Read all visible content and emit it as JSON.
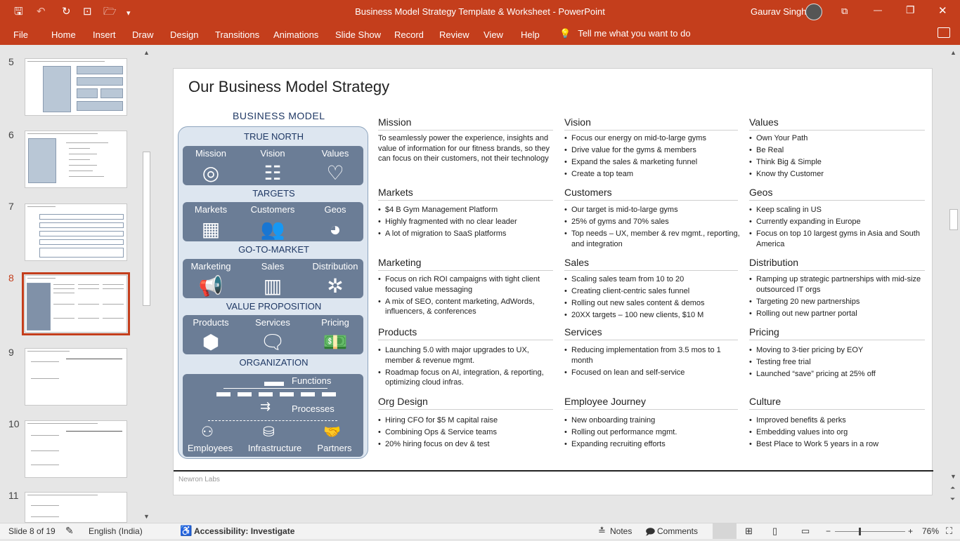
{
  "window": {
    "doc_title": "Business Model Strategy Template & Worksheet  -  PowerPoint",
    "user_name": "Gaurav Singh",
    "qa_save": "🖫",
    "qa_undo": "↶",
    "qa_redo": "↻",
    "qa_present": "⊡",
    "qa_open": "🗁",
    "qa_more": "▾",
    "win_restore": "⧉",
    "win_min": "—",
    "win_max": "❐",
    "win_close": "✕"
  },
  "ribbon": {
    "tabs": [
      "File",
      "Home",
      "Insert",
      "Draw",
      "Design",
      "Transitions",
      "Animations",
      "Slide Show",
      "Record",
      "Review",
      "View",
      "Help"
    ],
    "tell_me": "Tell me what you want to do",
    "bulb": "💡"
  },
  "thumbnails": {
    "numbers": [
      "5",
      "6",
      "7",
      "8",
      "9",
      "10",
      "11"
    ],
    "selected": "8"
  },
  "statusbar": {
    "slide_count": "Slide 8 of 19",
    "language": "English (India)",
    "accessibility": "Accessibility: Investigate",
    "notes": "Notes",
    "comments": "Comments",
    "zoom": "76%",
    "minus": "−",
    "plus": "+"
  },
  "slide": {
    "title": "Our Business Model Strategy",
    "bm_title": "BUSINESS MODEL",
    "footer": "Newron Labs",
    "sections": {
      "true_north": {
        "label": "TRUE NORTH",
        "items": [
          "Mission",
          "Vision",
          "Values"
        ]
      },
      "targets": {
        "label": "TARGETS",
        "items": [
          "Markets",
          "Customers",
          "Geos"
        ]
      },
      "gtm": {
        "label": "GO-TO-MARKET",
        "items": [
          "Marketing",
          "Sales",
          "Distribution"
        ]
      },
      "vp": {
        "label": "VALUE PROPOSITION",
        "items": [
          "Products",
          "Services",
          "Pricing"
        ]
      },
      "org": {
        "label": "ORGANIZATION",
        "functions": "Functions",
        "processes": "Processes",
        "items": [
          "Employees",
          "Infrastructure",
          "Partners"
        ]
      }
    },
    "rows": [
      [
        {
          "head": "Mission",
          "para": "To seamlessly power the experience, insights and value of information for our fitness brands, so they can focus on their customers, not their technology"
        },
        {
          "head": "Vision",
          "bullets": [
            "Focus our energy on mid-to-large gyms",
            "Drive value for the gyms & members",
            "Expand the sales & marketing funnel",
            "Create a top team"
          ]
        },
        {
          "head": "Values",
          "bullets": [
            "Own Your Path",
            "Be Real",
            "Think Big & Simple",
            "Know thy Customer"
          ]
        }
      ],
      [
        {
          "head": "Markets",
          "bullets": [
            "$4 B Gym Management Platform",
            "Highly fragmented with no clear leader",
            "A lot of migration to SaaS platforms"
          ]
        },
        {
          "head": "Customers",
          "bullets": [
            "Our target is mid-to-large gyms",
            "25% of gyms and 70% sales",
            "Top needs – UX, member & rev mgmt., reporting, and integration"
          ]
        },
        {
          "head": "Geos",
          "bullets": [
            "Keep scaling in US",
            "Currently expanding in Europe",
            "Focus on top 10 largest gyms in Asia and South America"
          ]
        }
      ],
      [
        {
          "head": "Marketing",
          "bullets": [
            "Focus on rich ROI campaigns with tight client focused value messaging",
            "A mix of SEO, content marketing, AdWords, influencers, & conferences"
          ]
        },
        {
          "head": "Sales",
          "bullets": [
            "Scaling sales team from 10 to 20",
            "Creating client-centric sales funnel",
            "Rolling out new sales content & demos",
            "20XX targets – 100 new clients, $10 M"
          ]
        },
        {
          "head": "Distribution",
          "bullets": [
            "Ramping up strategic partnerships with mid-size outsourced IT orgs",
            "Targeting 20 new partnerships",
            "Rolling out new partner portal"
          ]
        }
      ],
      [
        {
          "head": "Products",
          "bullets": [
            "Launching 5.0 with major upgrades to UX, member & revenue mgmt.",
            "Roadmap focus on AI, integration, & reporting, optimizing cloud infras."
          ]
        },
        {
          "head": "Services",
          "bullets": [
            "Reducing implementation from 3.5 mos to 1 month",
            "Focused on lean and self-service"
          ]
        },
        {
          "head": "Pricing",
          "bullets": [
            "Moving to 3-tier pricing by EOY",
            "Testing free trial",
            "Launched “save” pricing at 25% off"
          ]
        }
      ],
      [
        {
          "head": "Org Design",
          "bullets": [
            "Hiring CFO for $5 M capital raise",
            "Combining Ops & Service teams",
            "20% hiring focus on dev & test"
          ]
        },
        {
          "head": "Employee Journey",
          "bullets": [
            "New onboarding training",
            "Rolling out performance mgmt.",
            "Expanding recruiting efforts"
          ]
        },
        {
          "head": "Culture",
          "bullets": [
            "Improved benefits & perks",
            "Embedding values into org",
            "Best Place to Work 5 years in a row"
          ]
        }
      ]
    ]
  }
}
